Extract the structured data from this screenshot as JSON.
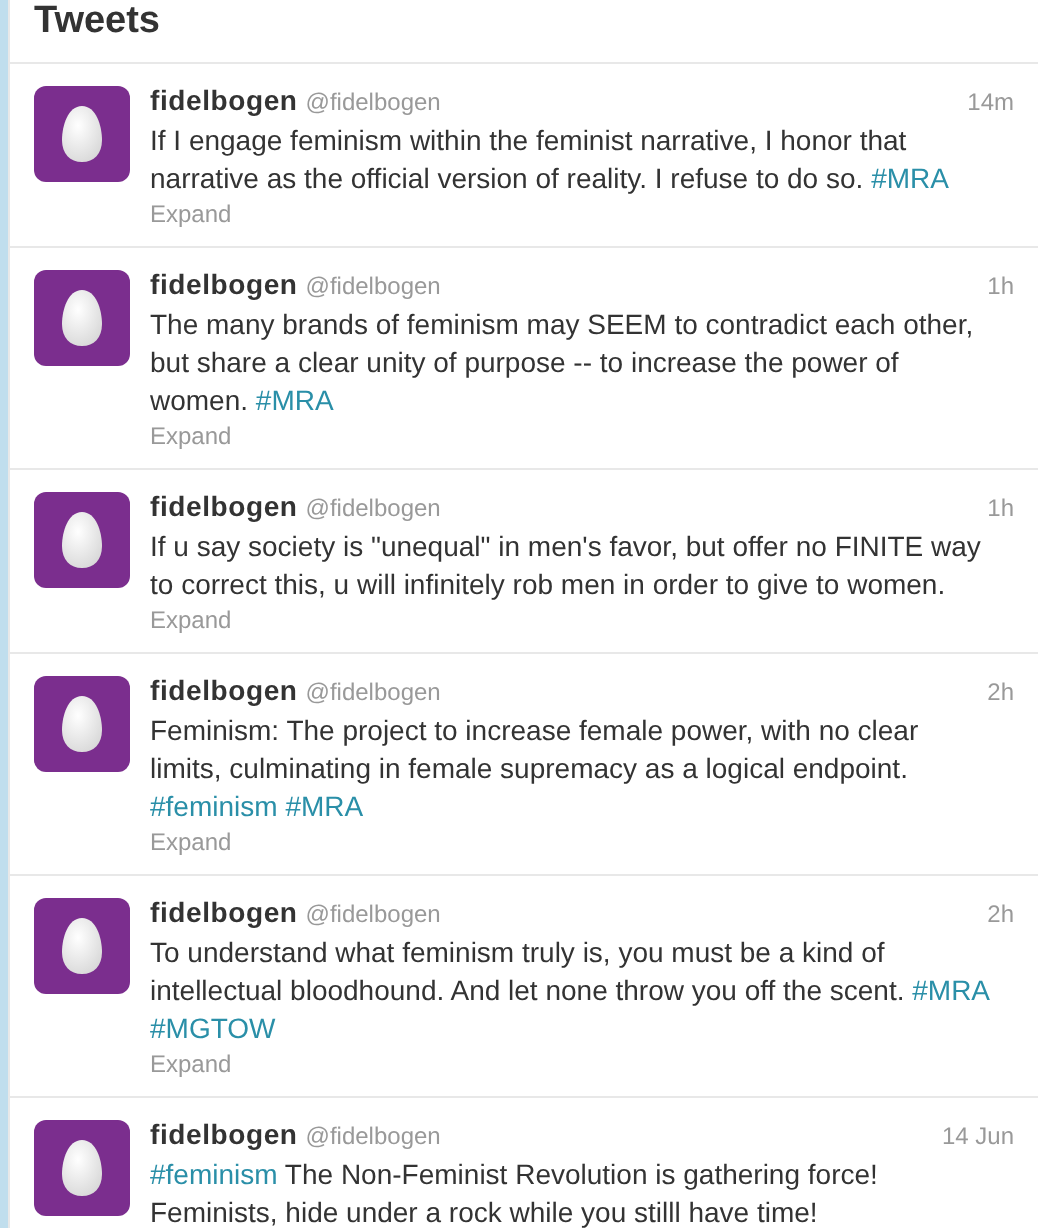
{
  "header": {
    "title": "Tweets"
  },
  "tweets": [
    {
      "name": "fidelbogen",
      "handle": "@fidelbogen",
      "time": "14m",
      "segments": [
        {
          "kind": "text",
          "text": "If I engage feminism within the feminist narrative, I honor that narrative as the official version of reality. I refuse to do so. "
        },
        {
          "kind": "hashtag",
          "text": "#MRA"
        }
      ],
      "expand": "Expand"
    },
    {
      "name": "fidelbogen",
      "handle": "@fidelbogen",
      "time": "1h",
      "segments": [
        {
          "kind": "text",
          "text": "The many brands of feminism may SEEM to contradict each other, but share a clear unity of purpose -- to increase the power of women. "
        },
        {
          "kind": "hashtag",
          "text": "#MRA"
        }
      ],
      "expand": "Expand"
    },
    {
      "name": "fidelbogen",
      "handle": "@fidelbogen",
      "time": "1h",
      "segments": [
        {
          "kind": "text",
          "text": "If u say society is \"unequal\" in men's favor, but offer no FINITE way to correct this, u will infinitely rob men in order to give to women."
        }
      ],
      "expand": "Expand"
    },
    {
      "name": "fidelbogen",
      "handle": "@fidelbogen",
      "time": "2h",
      "segments": [
        {
          "kind": "text",
          "text": "Feminism: The project to increase female power, with no clear limits, culminating in female supremacy as a logical endpoint. "
        },
        {
          "kind": "hashtag",
          "text": "#feminism"
        },
        {
          "kind": "hashtag",
          "text": "#MRA"
        }
      ],
      "expand": "Expand"
    },
    {
      "name": "fidelbogen",
      "handle": "@fidelbogen",
      "time": "2h",
      "segments": [
        {
          "kind": "text",
          "text": "To understand what feminism truly is, you must be a kind of intellectual bloodhound. And let none throw you off the scent. "
        },
        {
          "kind": "hashtag",
          "text": "#MRA"
        },
        {
          "kind": "hashtag",
          "text": "#MGTOW"
        }
      ],
      "expand": "Expand"
    },
    {
      "name": "fidelbogen",
      "handle": "@fidelbogen",
      "time": "14 Jun",
      "segments": [
        {
          "kind": "hashtag",
          "text": "#feminism"
        },
        {
          "kind": "text",
          "text": " The Non-Feminist Revolution is gathering force! Feminists, hide under a rock while you stilll have time!"
        }
      ]
    }
  ]
}
